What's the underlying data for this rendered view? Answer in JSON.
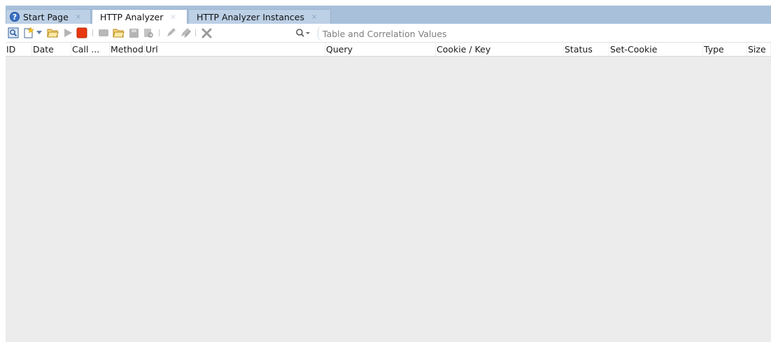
{
  "tabs": [
    {
      "label": "Start Page",
      "icon": "help-icon"
    },
    {
      "label": "HTTP Analyzer"
    },
    {
      "label": "HTTP Analyzer Instances"
    }
  ],
  "help_glyph": "?",
  "close_glyph": "×",
  "toolbar": {
    "search_placeholder": "Table and Correlation Values",
    "icons": [
      "analyzer-icon",
      "new-item-icon",
      "dropdown-arrow-icon",
      "open-folder-icon",
      "play-icon",
      "stop-icon",
      "rectangle-icon",
      "folder-icon",
      "save-icon",
      "inspect-icon",
      "edit-icon",
      "edit-multi-icon",
      "delete-icon",
      "search-icon"
    ]
  },
  "columns": [
    "ID",
    "Date",
    "Call ...",
    "Method",
    "Url",
    "Query",
    "Cookie / Key",
    "Status",
    "Set-Cookie",
    "Type",
    "Size"
  ],
  "colors": {
    "tab_strip": "#a8c0da",
    "stop": "#e8380f",
    "background": "#ececec"
  }
}
